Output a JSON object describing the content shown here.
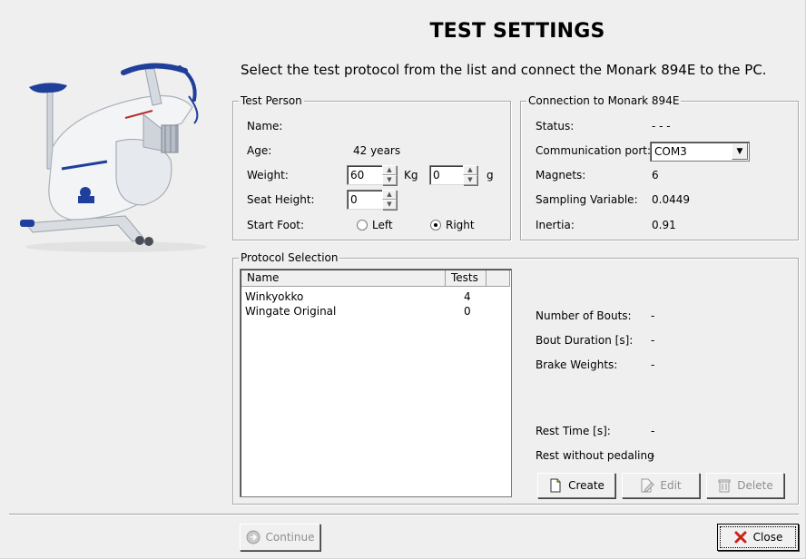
{
  "header": {
    "title": "TEST SETTINGS",
    "subtitle": "Select the test protocol from the list and connect the Monark 894E to the PC."
  },
  "test_person": {
    "group_title": "Test Person",
    "name_label": "Name:",
    "age_label": "Age:",
    "age_value": "42 years",
    "weight_label": "Weight:",
    "weight_kg_value": "60",
    "kg_unit": "Kg",
    "weight_g_value": "0",
    "g_unit": "g",
    "seat_height_label": "Seat Height:",
    "seat_height_value": "0",
    "start_foot_label": "Start Foot:",
    "left_label": "Left",
    "right_label": "Right",
    "selected_foot": "Right"
  },
  "connection": {
    "group_title": "Connection to Monark 894E",
    "status_label": "Status:",
    "status_value": "- - -",
    "port_label": "Communication port:",
    "port_value": "COM3",
    "magnets_label": "Magnets:",
    "magnets_value": "6",
    "sampling_label": "Sampling Variable:",
    "sampling_value": "0.0449",
    "inertia_label": "Inertia:",
    "inertia_value": "0.91"
  },
  "protocol": {
    "group_title": "Protocol Selection",
    "columns": [
      "Name",
      "Tests"
    ],
    "rows": [
      {
        "name": "Winkyokko",
        "tests": "4"
      },
      {
        "name": "Wingate Original",
        "tests": "0"
      }
    ],
    "details": {
      "bouts_label": "Number of Bouts:",
      "bouts_value": "-",
      "duration_label": "Bout Duration [s]:",
      "duration_value": "-",
      "brake_label": "Brake Weights:",
      "brake_value": "-",
      "rest_label": "Rest Time [s]:",
      "rest_value": "-",
      "rest_nopedal_label": "Rest without pedaling",
      "rest_nopedal_value": "-"
    },
    "create_label": "Create",
    "edit_label": "Edit",
    "delete_label": "Delete"
  },
  "footer": {
    "continue_label": "Continue",
    "close_label": "Close"
  },
  "icons": {
    "create": "new-document-icon",
    "edit": "edit-document-icon",
    "delete": "trash-icon",
    "continue": "arrow-right-circle-icon",
    "close": "red-x-icon"
  },
  "colors": {
    "window_bg": "#efefef",
    "bike_accent": "#1f3f9a",
    "close_icon": "#c8221a"
  }
}
